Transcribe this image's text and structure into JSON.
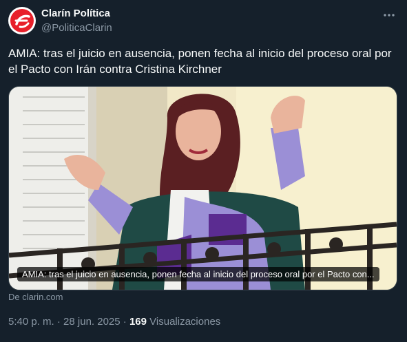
{
  "account": {
    "name": "Clarín Política",
    "handle": "@PoliticaClarin",
    "avatar_color": "#e8202a"
  },
  "more_icon": "more-dots-icon",
  "tweet_text": "AMIA: tras el juicio en ausencia, ponen fecha al inicio del proceso oral por el Pacto con Irán contra Cristina Kirchner",
  "card": {
    "caption": "AMIA: tras el juicio en ausencia, ponen fecha al inicio del proceso oral por el Pacto con...",
    "source": "De clarin.com"
  },
  "meta": {
    "time": "5:40 p. m.",
    "separator": " · ",
    "date": "28 jun. 2025",
    "views_count": "169",
    "views_label": " Visualizaciones"
  },
  "colors": {
    "background": "#15202b",
    "text": "#f7f9f9",
    "secondary": "#8b98a5",
    "border": "#38444d"
  }
}
